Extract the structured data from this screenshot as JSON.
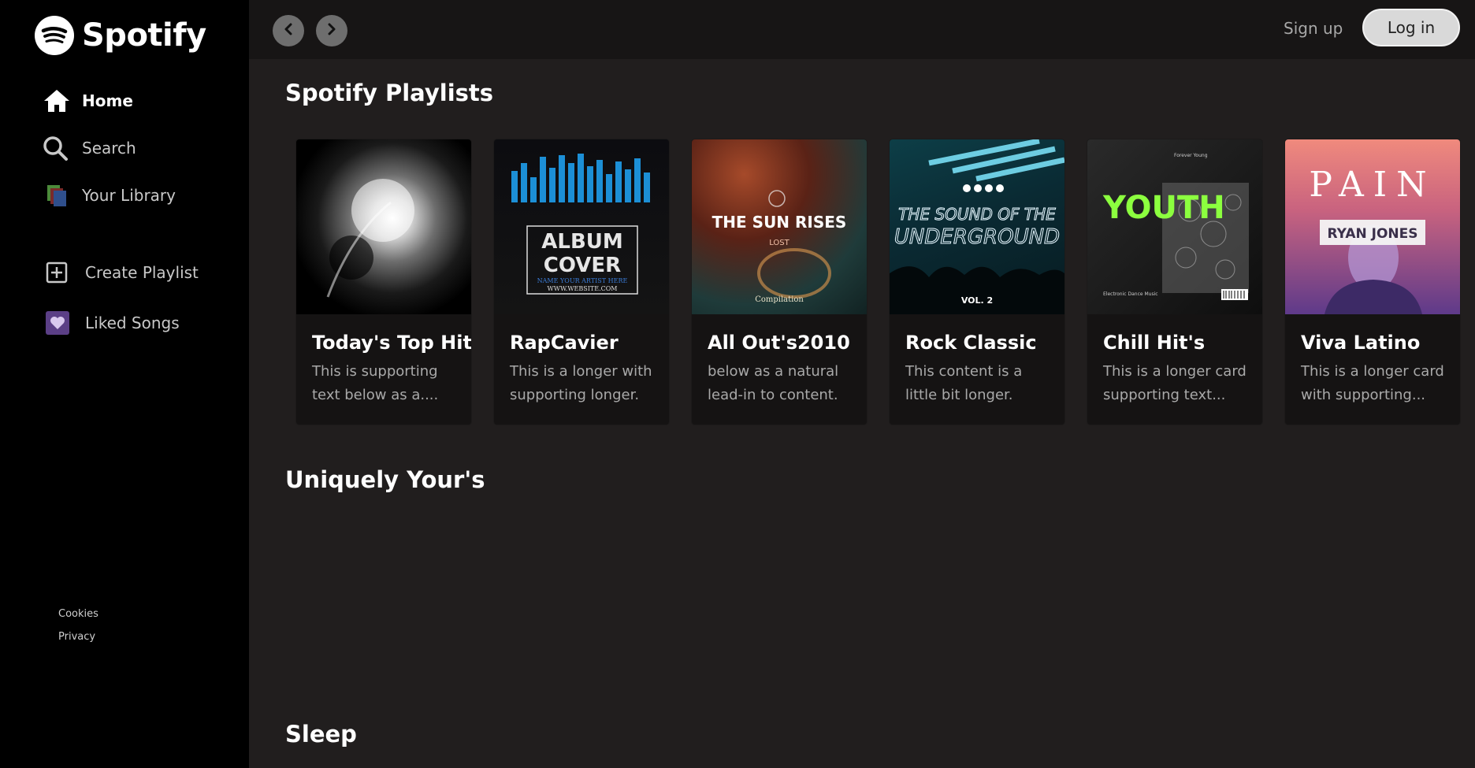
{
  "brand": {
    "name": "Spotify"
  },
  "sidebar": {
    "items": [
      {
        "label": "Home",
        "icon": "home-icon"
      },
      {
        "label": "Search",
        "icon": "search-icon"
      },
      {
        "label": "Your Library",
        "icon": "library-icon"
      }
    ],
    "actions": [
      {
        "label": "Create Playlist",
        "icon": "plus-square-icon"
      },
      {
        "label": "Liked Songs",
        "icon": "heart-icon"
      }
    ],
    "footer": [
      "Cookies",
      "Privacy"
    ]
  },
  "topbar": {
    "signup": "Sign up",
    "login": "Log in"
  },
  "sections": [
    {
      "title": "Spotify Playlists"
    },
    {
      "title": "Uniquely Your's"
    },
    {
      "title": "Sleep"
    }
  ],
  "cards": [
    {
      "title": "Today's Top Hit",
      "text": "This is supporting text below as a....",
      "art": "black-white-explosion"
    },
    {
      "title": "RapCavier",
      "text": "This is a longer with supporting longer.",
      "art_line1": "ALBUM",
      "art_line2": "COVER",
      "art_line3": "NAME YOUR ARTIST HERE",
      "art_line4": "WWW.WEBSITE.COM"
    },
    {
      "title": "All Out's2010",
      "text": "below as a natural lead-in to content.",
      "art_line1": "THE SUN RISES",
      "art_line2": "LOST",
      "art_line3": "Compilation"
    },
    {
      "title": "Rock Classic",
      "text": "This content is a little bit longer.",
      "art_line1": "THE SOUND OF THE",
      "art_line2": "UNDERGROUND",
      "art_line3": "VOL. 2"
    },
    {
      "title": "Chill Hit's",
      "text": "This is a longer card supporting text...",
      "art_line1": "YOUTH",
      "art_line2": "Electronic Dance Music",
      "art_line3": "Forever Young"
    },
    {
      "title": "Viva Latino",
      "text": "This is a longer card with supporting...",
      "art_line1": "PAIN",
      "art_line2": "RYAN JONES"
    }
  ],
  "colors": {
    "sidebar": "#000000",
    "main": "#211e1e",
    "topbar": "#171515",
    "accent_green": "#8cff3f",
    "card": "#151313"
  }
}
